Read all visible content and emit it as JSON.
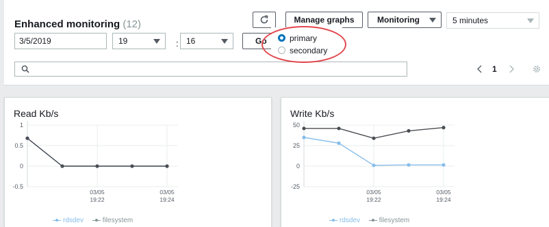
{
  "header": {
    "title": "Enhanced monitoring",
    "count": "(12)"
  },
  "filters": {
    "date": "3/5/2019",
    "hour": "19",
    "colon": ":",
    "minute": "16",
    "go_label": "Go"
  },
  "toolbar": {
    "manage_graphs": "Manage graphs",
    "monitoring": "Monitoring",
    "period": "5 minutes"
  },
  "instance_options": {
    "items": [
      {
        "label": "primary",
        "checked": true
      },
      {
        "label": "secondary",
        "checked": false
      }
    ]
  },
  "search": {
    "placeholder": ""
  },
  "pagination": {
    "page": "1"
  },
  "icons": {
    "refresh": "refresh-icon",
    "search": "search-icon",
    "prev": "chevron-left-icon",
    "next": "chevron-right-icon",
    "settings": "gear-icon"
  },
  "colors": {
    "rdsdev": "#86bdea",
    "filesystem": "#4a4d52",
    "radio_selected": "#0073bb",
    "highlight": "#e2464d"
  },
  "chart_data": [
    {
      "type": "line",
      "title": "Read Kb/s",
      "yticks": [
        1,
        0.5,
        0,
        -0.5
      ],
      "ylim": [
        -0.5,
        1
      ],
      "xticks": [
        "03/05\n19:22",
        "03/05\n19:24"
      ],
      "series": [
        {
          "name": "rdsdev",
          "values": [
            0.68,
            0,
            0,
            0,
            0
          ]
        },
        {
          "name": "filesystem",
          "values": [
            0.68,
            0,
            0,
            0,
            0
          ]
        }
      ],
      "legend": "bottom"
    },
    {
      "type": "line",
      "title": "Write Kb/s",
      "yticks": [
        50,
        25,
        0,
        -25
      ],
      "ylim": [
        -25,
        50
      ],
      "xticks": [
        "03/05\n19:22",
        "03/05\n19:24"
      ],
      "series": [
        {
          "name": "rdsdev",
          "values": [
            35,
            28,
            1,
            1.5,
            1.5
          ]
        },
        {
          "name": "filesystem",
          "values": [
            46,
            46,
            34,
            43,
            47
          ]
        }
      ],
      "legend": "bottom"
    }
  ]
}
